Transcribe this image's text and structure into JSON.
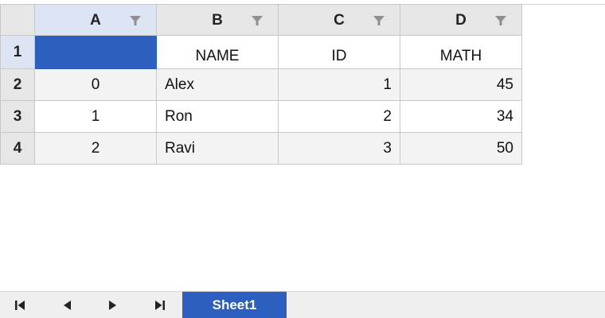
{
  "columns": [
    {
      "letter": "A",
      "icon": "filter-icon"
    },
    {
      "letter": "B",
      "icon": "filter-icon"
    },
    {
      "letter": "C",
      "icon": "filter-icon"
    },
    {
      "letter": "D",
      "icon": "filter-icon"
    }
  ],
  "rows": [
    {
      "num": "1",
      "a": "",
      "b": "NAME",
      "c": "ID",
      "d": "MATH"
    },
    {
      "num": "2",
      "a": "0",
      "b": "Alex",
      "c": "1",
      "d": "45"
    },
    {
      "num": "3",
      "a": "1",
      "b": "Ron",
      "c": "2",
      "d": "34"
    },
    {
      "num": "4",
      "a": "2",
      "b": "Ravi",
      "c": "3",
      "d": "50"
    }
  ],
  "selection": {
    "active_cell": "A1",
    "highlight_color": "#2d5fc0"
  },
  "sheetbar": {
    "nav": [
      "first-sheet-icon",
      "prev-sheet-icon",
      "next-sheet-icon",
      "last-sheet-icon"
    ],
    "tabs": [
      {
        "label": "Sheet1",
        "active": true
      }
    ]
  }
}
